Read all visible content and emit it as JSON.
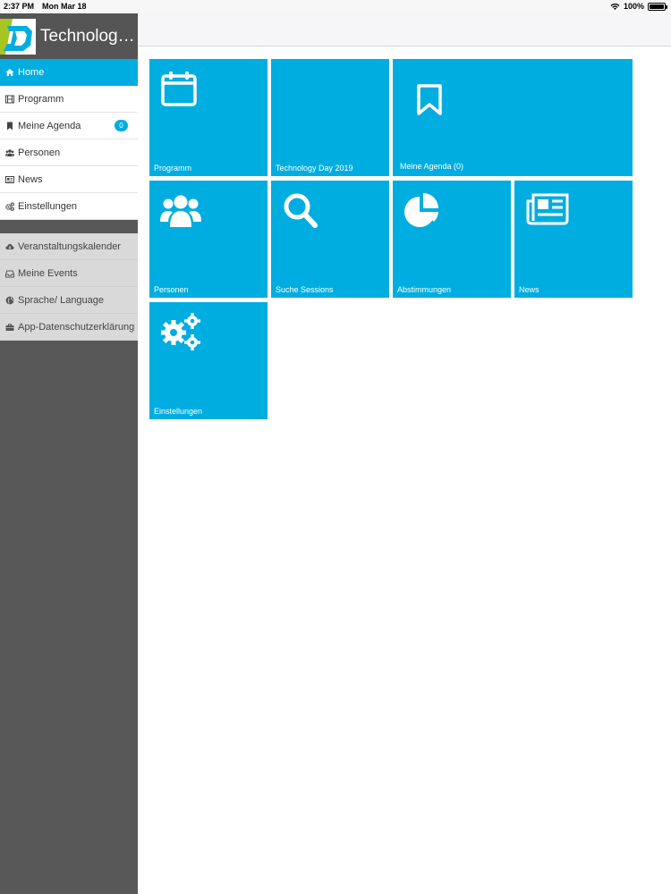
{
  "status_bar": {
    "time": "2:37 PM",
    "date": "Mon Mar 18",
    "battery": "100%",
    "battery_level": 1.0,
    "wifi_icon": "wifi-icon"
  },
  "brand": {
    "title": "Technolog…",
    "logo_icon": "td-logo-icon"
  },
  "sidebar": {
    "items": [
      {
        "label": "Home",
        "icon": "home-icon",
        "active": true
      },
      {
        "label": "Programm",
        "icon": "film-icon"
      },
      {
        "label": "Meine Agenda",
        "icon": "bookmark-icon",
        "badge": "0"
      },
      {
        "label": "Personen",
        "icon": "users-icon"
      },
      {
        "label": "News",
        "icon": "newspaper-icon"
      },
      {
        "label": "Einstellungen",
        "icon": "gears-icon"
      }
    ],
    "secondary_items": [
      {
        "label": "Veranstaltungskalender",
        "icon": "cloud-download-icon"
      },
      {
        "label": "Meine Events",
        "icon": "inbox-icon"
      },
      {
        "label": "Sprache/ Language",
        "icon": "globe-icon"
      },
      {
        "label": "App-Datenschutzerklärung",
        "icon": "briefcase-icon"
      }
    ]
  },
  "tiles": [
    {
      "label": "Programm",
      "icon": "calendar-icon"
    },
    {
      "label": "Technology Day 2019",
      "icon": ""
    },
    {
      "label": "Meine Agenda (0)",
      "icon": "bookmark-icon"
    },
    {
      "label": "Personen",
      "icon": "users-icon"
    },
    {
      "label": "Suche Sessions",
      "icon": "search-icon"
    },
    {
      "label": "Abstimmungen",
      "icon": "pie-chart-icon"
    },
    {
      "label": "News",
      "icon": "newspaper-icon"
    },
    {
      "label": "Einstellungen",
      "icon": "gears-icon"
    }
  ],
  "colors": {
    "accent": "#00ade0",
    "sidebar_bg": "#585858",
    "menu_bg": "#ffffff",
    "secondary_menu_bg": "#d9d9d9"
  }
}
